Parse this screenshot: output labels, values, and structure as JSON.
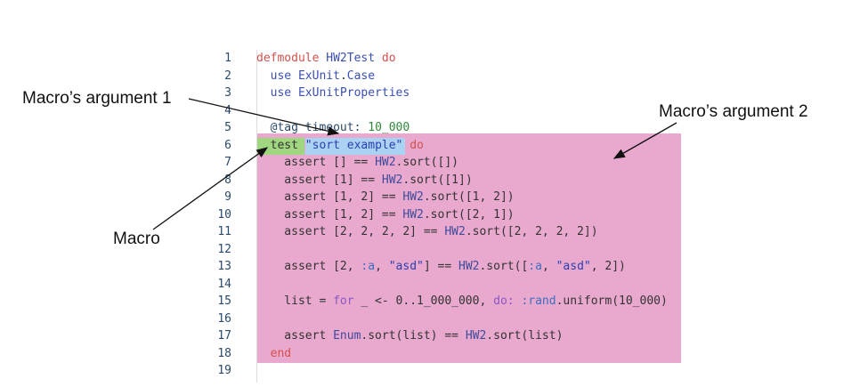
{
  "annotations": {
    "arg1": "Macro’s argument 1",
    "arg2": "Macro’s argument 2",
    "macro": "Macro"
  },
  "code": {
    "line_numbers": [
      "1",
      "2",
      "3",
      "4",
      "5",
      "6",
      "7",
      "8",
      "9",
      "10",
      "11",
      "12",
      "13",
      "14",
      "15",
      "16",
      "17",
      "18",
      "19"
    ],
    "lines": [
      [
        {
          "t": "defmodule ",
          "c": "kw"
        },
        {
          "t": "HW2Test ",
          "c": "mod"
        },
        {
          "t": "do",
          "c": "kw"
        }
      ],
      [
        {
          "t": "  use ",
          "c": "mod"
        },
        {
          "t": "ExUnit",
          "c": "mod"
        },
        {
          "t": ".",
          "c": "plain"
        },
        {
          "t": "Case",
          "c": "mod"
        }
      ],
      [
        {
          "t": "  use ",
          "c": "mod"
        },
        {
          "t": "ExUnitProperties",
          "c": "mod"
        }
      ],
      [],
      [
        {
          "t": "  @tag ",
          "c": "attr"
        },
        {
          "t": "timeout: ",
          "c": "attr"
        },
        {
          "t": "10_000",
          "c": "num"
        }
      ],
      [
        {
          "t": "  test ",
          "c": "plain"
        },
        {
          "t": "\"sort example\"",
          "c": "str"
        },
        {
          "t": " do",
          "c": "kw"
        }
      ],
      [
        {
          "t": "    assert ",
          "c": "plain"
        },
        {
          "t": "[] == ",
          "c": "plain"
        },
        {
          "t": "HW2",
          "c": "call"
        },
        {
          "t": ".sort(",
          "c": "plain"
        },
        {
          "t": "[]",
          "c": "plain"
        },
        {
          "t": ")",
          "c": "plain"
        }
      ],
      [
        {
          "t": "    assert ",
          "c": "plain"
        },
        {
          "t": "[1] == ",
          "c": "plain"
        },
        {
          "t": "HW2",
          "c": "call"
        },
        {
          "t": ".sort(",
          "c": "plain"
        },
        {
          "t": "[1]",
          "c": "plain"
        },
        {
          "t": ")",
          "c": "plain"
        }
      ],
      [
        {
          "t": "    assert ",
          "c": "plain"
        },
        {
          "t": "[1, 2] == ",
          "c": "plain"
        },
        {
          "t": "HW2",
          "c": "call"
        },
        {
          "t": ".sort(",
          "c": "plain"
        },
        {
          "t": "[1, 2]",
          "c": "plain"
        },
        {
          "t": ")",
          "c": "plain"
        }
      ],
      [
        {
          "t": "    assert ",
          "c": "plain"
        },
        {
          "t": "[1, 2] == ",
          "c": "plain"
        },
        {
          "t": "HW2",
          "c": "call"
        },
        {
          "t": ".sort(",
          "c": "plain"
        },
        {
          "t": "[2, 1]",
          "c": "plain"
        },
        {
          "t": ")",
          "c": "plain"
        }
      ],
      [
        {
          "t": "    assert ",
          "c": "plain"
        },
        {
          "t": "[2, 2, 2, 2] == ",
          "c": "plain"
        },
        {
          "t": "HW2",
          "c": "call"
        },
        {
          "t": ".sort(",
          "c": "plain"
        },
        {
          "t": "[2, 2, 2, 2]",
          "c": "plain"
        },
        {
          "t": ")",
          "c": "plain"
        }
      ],
      [],
      [
        {
          "t": "    assert ",
          "c": "plain"
        },
        {
          "t": "[2, ",
          "c": "plain"
        },
        {
          "t": ":a",
          "c": "atom"
        },
        {
          "t": ", ",
          "c": "plain"
        },
        {
          "t": "\"asd\"",
          "c": "str"
        },
        {
          "t": "] == ",
          "c": "plain"
        },
        {
          "t": "HW2",
          "c": "call"
        },
        {
          "t": ".sort(",
          "c": "plain"
        },
        {
          "t": "[",
          "c": "plain"
        },
        {
          "t": ":a",
          "c": "atom"
        },
        {
          "t": ", ",
          "c": "plain"
        },
        {
          "t": "\"asd\"",
          "c": "str"
        },
        {
          "t": ", 2]",
          "c": "plain"
        },
        {
          "t": ")",
          "c": "plain"
        }
      ],
      [],
      [
        {
          "t": "    list = ",
          "c": "plain"
        },
        {
          "t": "for",
          "c": "for"
        },
        {
          "t": " _ <- 0..1_000_000, ",
          "c": "plain"
        },
        {
          "t": "do:",
          "c": "for"
        },
        {
          "t": " ",
          "c": "plain"
        },
        {
          "t": ":rand",
          "c": "atom"
        },
        {
          "t": ".uniform(10_000)",
          "c": "plain"
        }
      ],
      [],
      [
        {
          "t": "    assert ",
          "c": "plain"
        },
        {
          "t": "Enum",
          "c": "call"
        },
        {
          "t": ".sort(list) == ",
          "c": "plain"
        },
        {
          "t": "HW2",
          "c": "call"
        },
        {
          "t": ".sort(list)",
          "c": "plain"
        }
      ],
      [
        {
          "t": "  end",
          "c": "kw"
        }
      ],
      []
    ]
  }
}
